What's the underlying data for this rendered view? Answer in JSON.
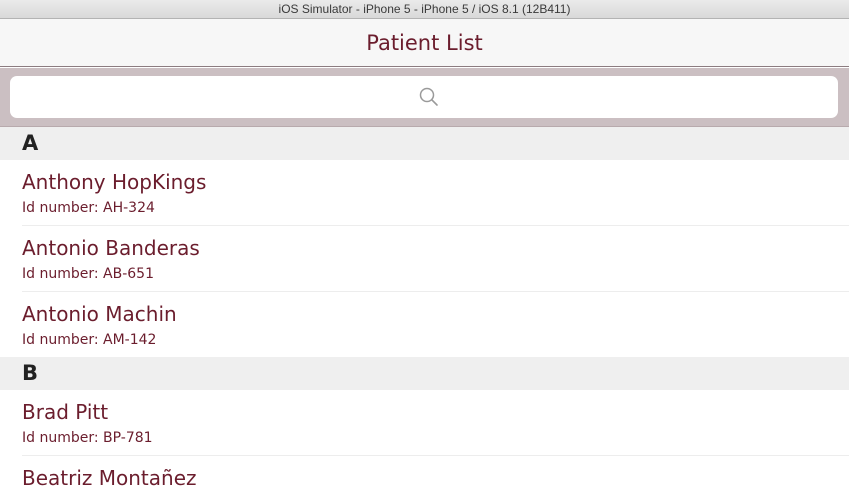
{
  "window": {
    "title": "iOS Simulator - iPhone 5 - iPhone 5 / iOS 8.1 (12B411)"
  },
  "navbar": {
    "title": "Patient List"
  },
  "search": {
    "icon": "search-icon",
    "placeholder": ""
  },
  "colors": {
    "accent": "#6b1d2d",
    "search_bar_bg": "#cbbfc2",
    "section_bg": "#efefef"
  },
  "sections": [
    {
      "letter": "A",
      "patients": [
        {
          "name": "Anthony HopKings",
          "id_text": "Id number: AH-324"
        },
        {
          "name": "Antonio Banderas",
          "id_text": "Id number: AB-651"
        },
        {
          "name": "Antonio Machin",
          "id_text": "Id number: AM-142"
        }
      ]
    },
    {
      "letter": "B",
      "patients": [
        {
          "name": "Brad Pitt",
          "id_text": "Id number: BP-781"
        },
        {
          "name": "Beatriz Montañez",
          "id_text": ""
        }
      ]
    }
  ]
}
